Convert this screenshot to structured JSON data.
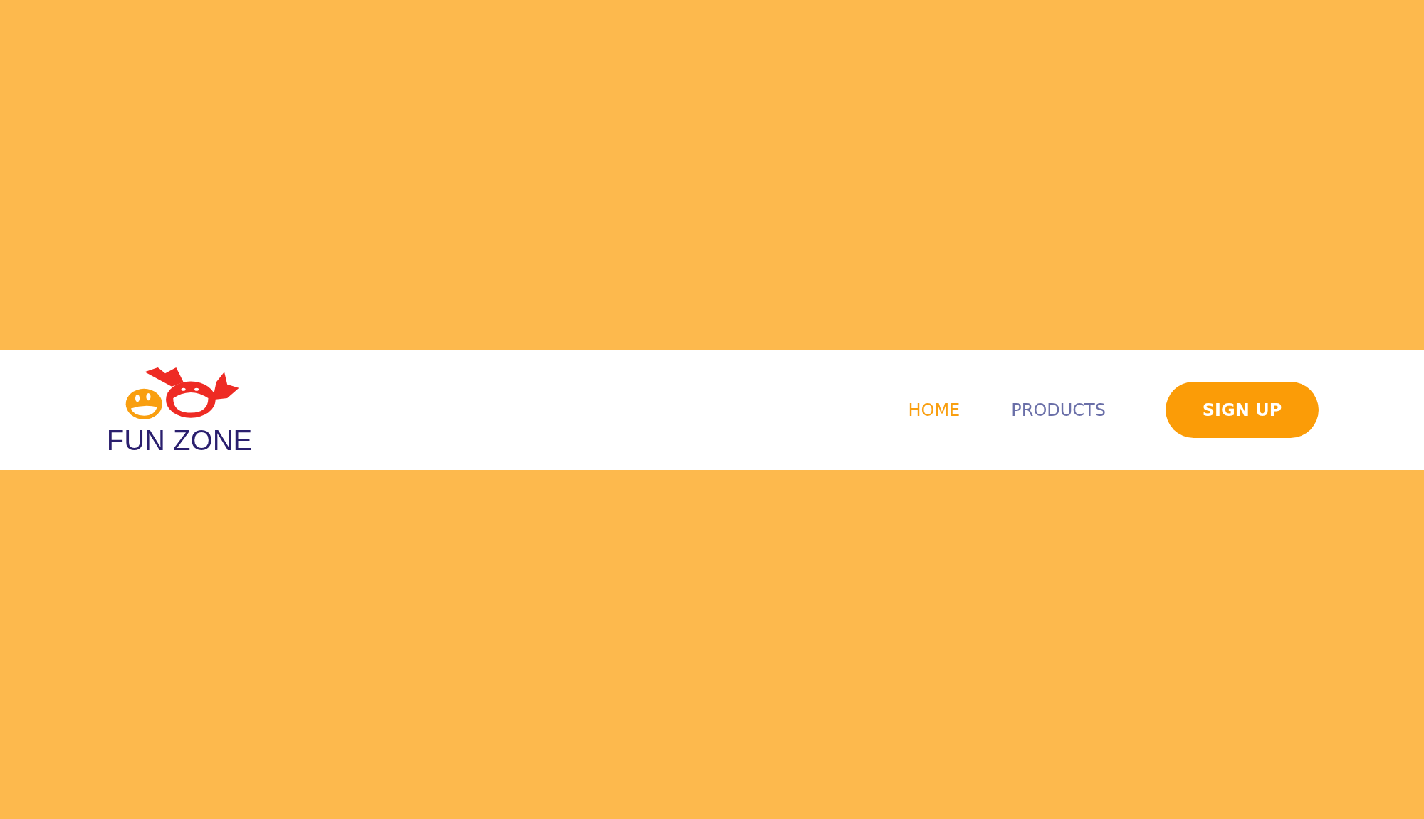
{
  "logo": {
    "text": "FUN ZONE"
  },
  "nav": [
    {
      "label": "HOME",
      "selected": true
    },
    {
      "label": "PRODUCTS",
      "selected": false
    }
  ],
  "signup_button": {
    "label": "SIGN UP"
  }
}
